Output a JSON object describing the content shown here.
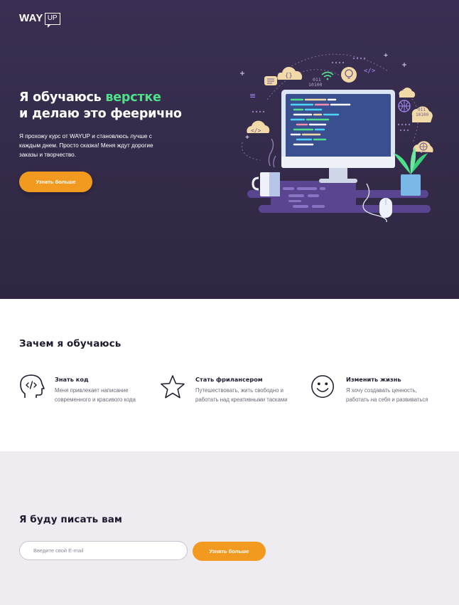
{
  "brand": {
    "logo_main": "WAY",
    "logo_box": "UP"
  },
  "hero": {
    "title_line1_pre": "Я обучаюсь ",
    "title_line1_accent": "верстке",
    "title_line2": "и делаю это феерично",
    "text": "Я прохожу курс от WAYUP и становлюсь лучше с каждым днем. Просто сказка! Меня ждут дорогие заказы и творчество.",
    "button_label": "Узнать больше",
    "illustration_labels": {
      "binary1": "011",
      "binary2": "10100",
      "code_tag": "</>",
      "braces": "{}"
    }
  },
  "why": {
    "title": "Зачем я обучаюсь",
    "features": [
      {
        "icon": "head-code-icon",
        "title": "Знать код",
        "line1": "Меня привлекает написание",
        "line2": "современного и красивого кода"
      },
      {
        "icon": "star-icon",
        "title": "Стать фрилансером",
        "line1": "Путешествовать, жить свободно и",
        "line2": "работать над креативными тасками"
      },
      {
        "icon": "smile-icon",
        "title": "Изменить жизнь",
        "line1": "Я хочу создавать ценность,",
        "line2": "работать на себя и развиваться"
      }
    ]
  },
  "subscribe": {
    "title": "Я буду писать вам",
    "email_placeholder": "Введите свой E-mail",
    "button_label": "Узнать больше"
  },
  "colors": {
    "hero_bg": "#332a48",
    "accent_green": "#4fe08a",
    "button_orange": "#f29a1f",
    "subscribe_bg": "#eeecf1"
  }
}
